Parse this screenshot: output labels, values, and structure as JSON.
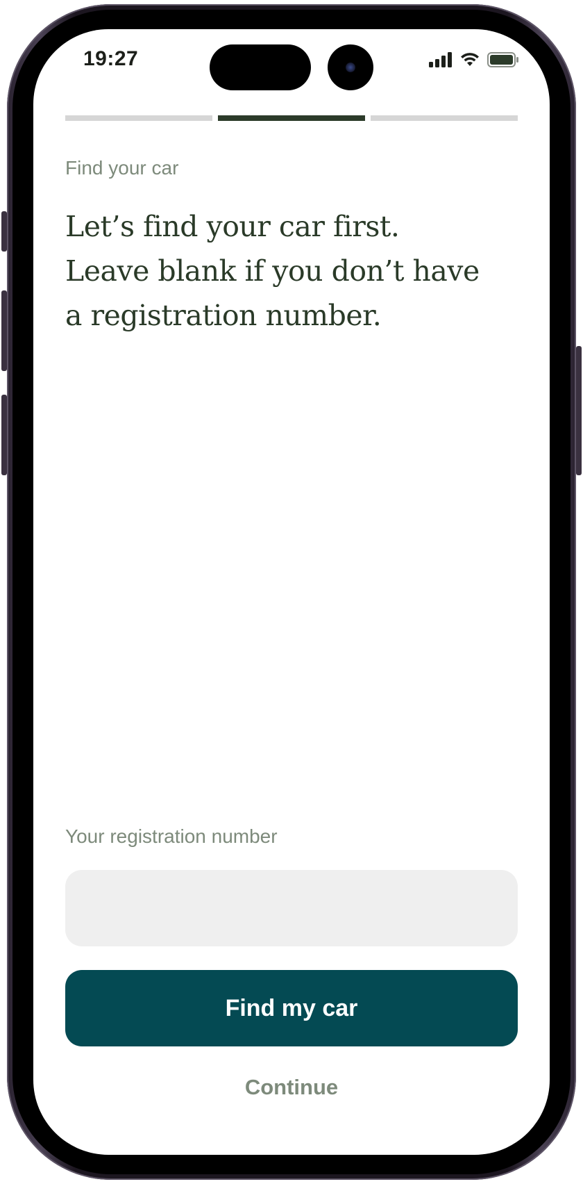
{
  "status_bar": {
    "time": "19:27"
  },
  "progress": {
    "steps": 3,
    "current_step": 2
  },
  "screen": {
    "eyebrow": "Find your car",
    "headline_lines": [
      "Let’s find your car first.",
      "Leave blank if you don’t have",
      "a registration number."
    ]
  },
  "form": {
    "registration_label": "Your registration number",
    "registration_value": ""
  },
  "actions": {
    "primary_label": "Find my car",
    "secondary_label": "Continue"
  },
  "colors": {
    "brand_dark": "#044a53",
    "headline": "#2a3a28",
    "muted_text": "#7d8a7b",
    "progress_active": "#2c3b2a",
    "progress_inactive": "#d6d6d6",
    "input_background": "#efefef"
  },
  "icons": {
    "signal": "cellular-signal-icon",
    "wifi": "wifi-icon",
    "battery": "battery-icon"
  }
}
